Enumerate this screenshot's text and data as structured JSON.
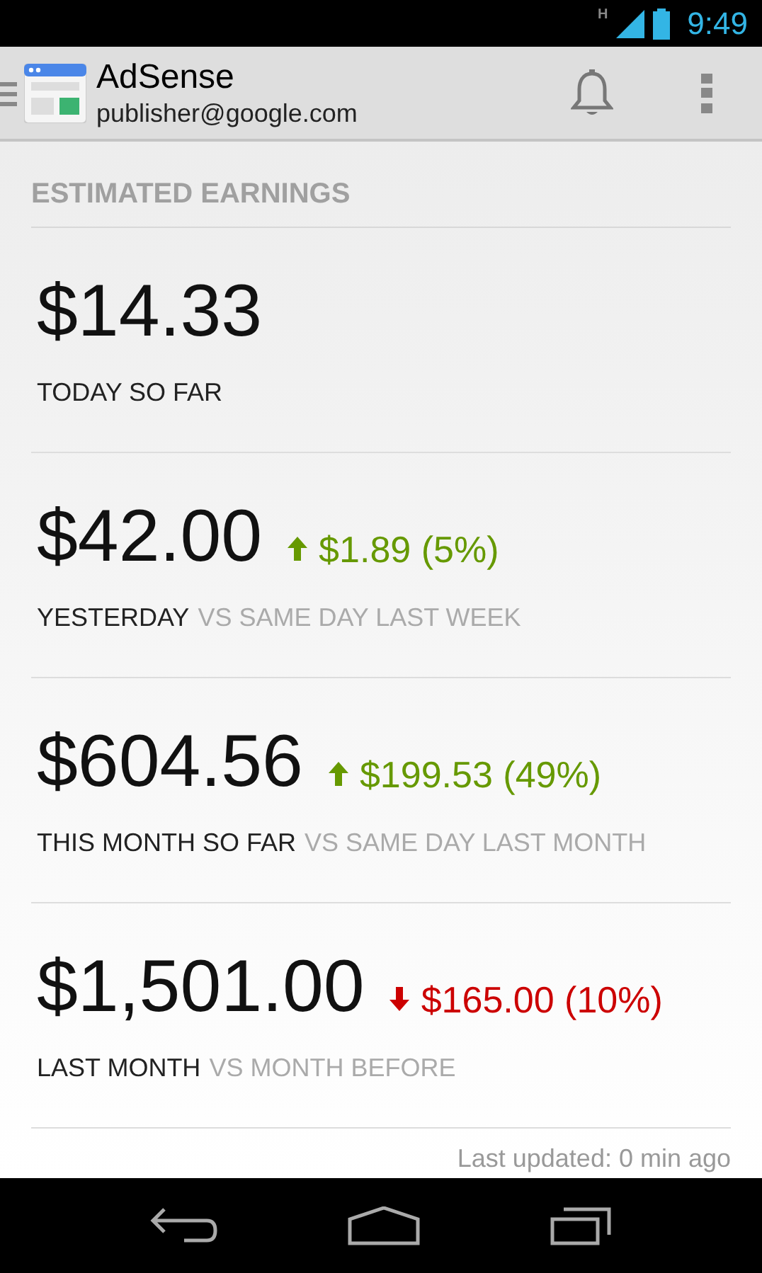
{
  "status_bar": {
    "network": "H",
    "time": "9:49"
  },
  "action_bar": {
    "title": "AdSense",
    "account": "publisher@google.com"
  },
  "section_title": "ESTIMATED EARNINGS",
  "earnings": [
    {
      "amount": "$14.33",
      "label": "TODAY SO FAR"
    },
    {
      "amount": "$42.00",
      "change": {
        "kind": "up",
        "text": "$1.89 (5%)"
      },
      "label": "YESTERDAY",
      "comparison": "VS SAME DAY LAST WEEK"
    },
    {
      "amount": "$604.56",
      "change": {
        "kind": "up",
        "text": "$199.53 (49%)"
      },
      "label": "THIS MONTH SO FAR",
      "comparison": "VS SAME DAY LAST MONTH"
    },
    {
      "amount": "$1,501.00",
      "change": {
        "kind": "down",
        "text": "$165.00 (10%)"
      },
      "label": "LAST MONTH",
      "comparison": "VS MONTH BEFORE"
    }
  ],
  "last_updated": "Last updated: 0 min ago"
}
